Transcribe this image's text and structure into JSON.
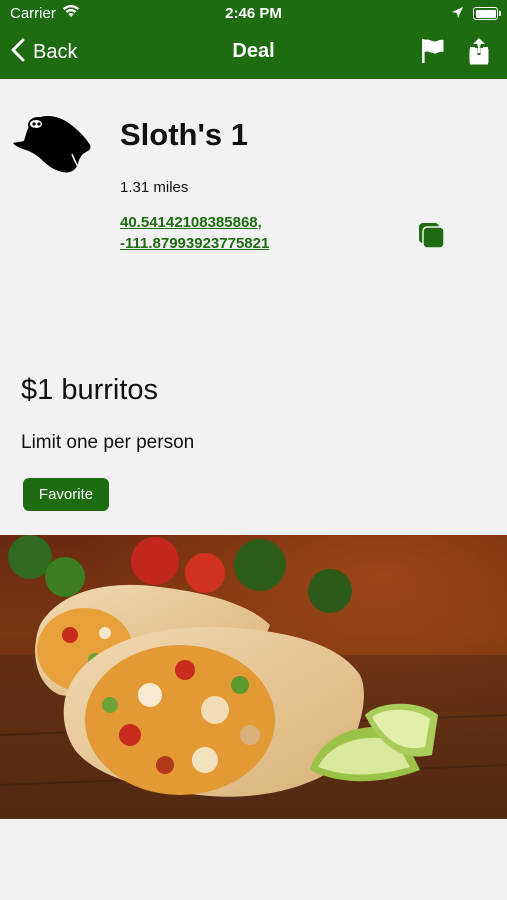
{
  "status_bar": {
    "carrier": "Carrier",
    "time": "2:46 PM"
  },
  "nav": {
    "back_label": "Back",
    "title": "Deal",
    "accent_color": "#1e6b12"
  },
  "place": {
    "name": "Sloth's 1",
    "distance": "1.31 miles",
    "coords_line1": "40.54142108385868,",
    "coords_line2": "-111.87993923775821"
  },
  "deal": {
    "title": "$1 burritos",
    "description": "Limit one per person",
    "favorite_label": "Favorite"
  },
  "icons": [
    "wifi-icon",
    "location-arrow-icon",
    "battery-icon",
    "chevron-left-icon",
    "flag-icon",
    "share-icon",
    "sloth-logo-icon",
    "copy-icon"
  ]
}
